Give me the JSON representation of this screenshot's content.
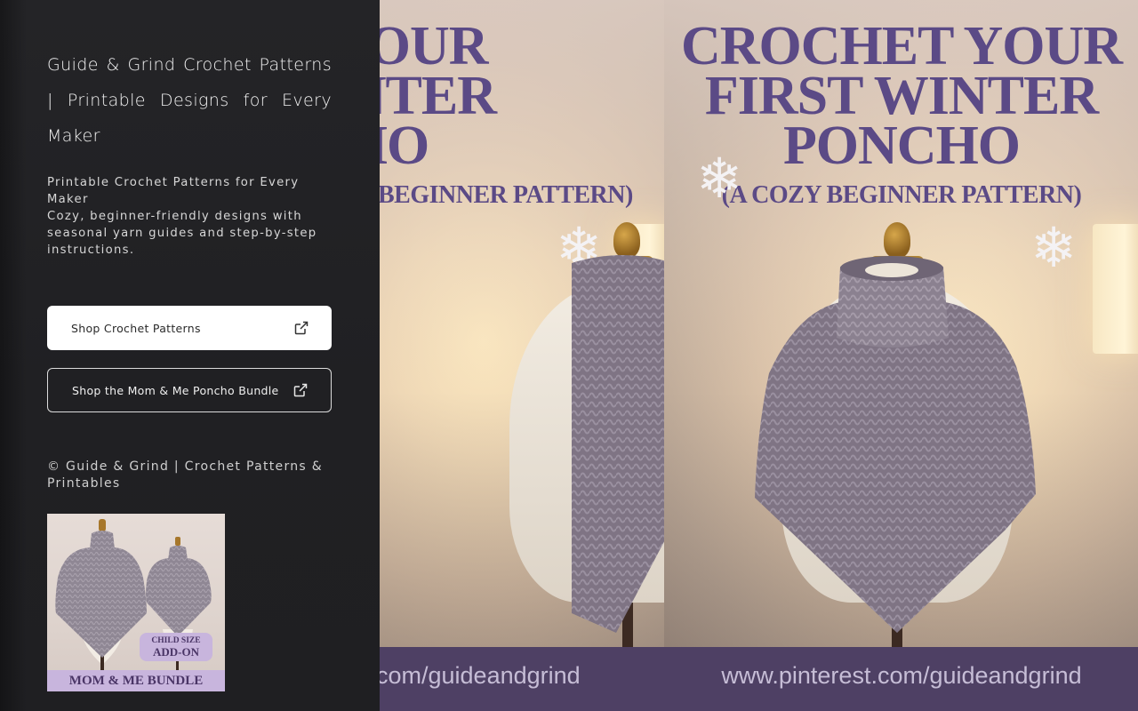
{
  "sidebar": {
    "title": "Guide & Grind Crochet Patterns | Printable Designs for Every Maker",
    "description_line1": "Printable Crochet Patterns for Every Maker",
    "description_line2": "Cozy, beginner-friendly designs with seasonal yarn guides and step-by-step instructions.",
    "buttons": [
      {
        "label": "Shop Crochet Patterns",
        "icon": "external-link-icon"
      },
      {
        "label": "Shop the Mom & Me Poncho Bundle",
        "icon": "external-link-icon"
      }
    ],
    "copyright": "© Guide & Grind | Crochet Patterns & Printables",
    "thumbnail": {
      "badge_line1": "CHILD SIZE",
      "badge_line2": "ADD-ON",
      "banner": "MOM & ME BUNDLE"
    }
  },
  "poster": {
    "headline_line1": "CROCHET YOUR",
    "headline_line2": "FIRST WINTER",
    "headline_line3": "PONCHO",
    "subline": "(A COZY BEGINNER PATTERN)",
    "url": "www.pinterest.com/guideandgrind",
    "left_crop": {
      "headline_line1": "HET YOUR",
      "headline_line2": "T WINTER",
      "headline_line3": "ONCHO",
      "subline": "BEGINNER PATTERN)",
      "url": "t.com/guideandgrind"
    }
  },
  "colors": {
    "panel_bg": "#222225",
    "headline": "#5b4a86",
    "banner": "#4e4064",
    "poncho": "#7f7484",
    "thumb_banner": "#c8b5dd"
  }
}
